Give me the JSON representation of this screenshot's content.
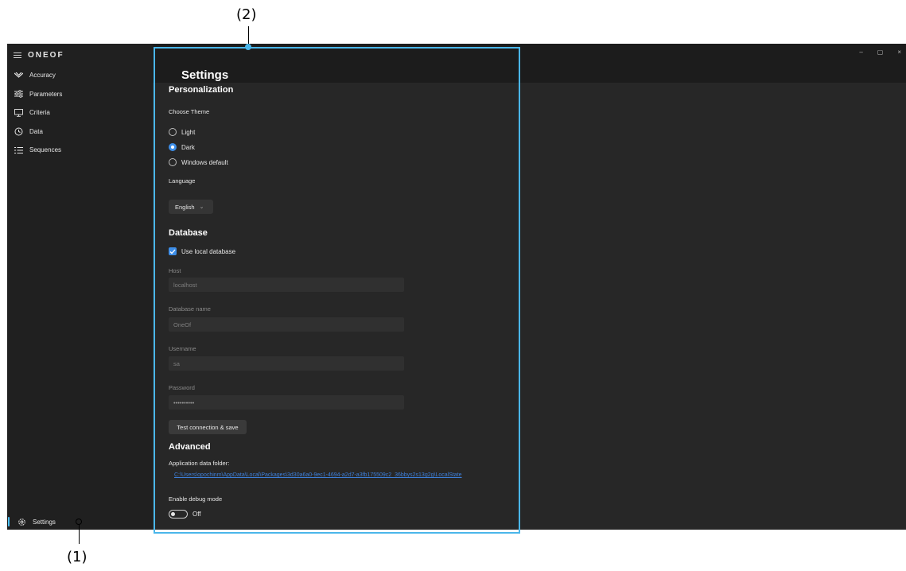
{
  "app": {
    "brand": "ONEOF",
    "window_controls": [
      "–",
      "▢",
      "×"
    ]
  },
  "sidebar": {
    "items": [
      {
        "label": "Accuracy",
        "icon": "bow-icon"
      },
      {
        "label": "Parameters",
        "icon": "sliders-icon"
      },
      {
        "label": "Criteria",
        "icon": "monitor-icon"
      },
      {
        "label": "Data",
        "icon": "clock-icon"
      },
      {
        "label": "Sequences",
        "icon": "list-icon"
      }
    ],
    "settings_label": "Settings"
  },
  "settings": {
    "title": "Settings",
    "personalization": {
      "heading": "Personalization",
      "choose_theme": "Choose Theme",
      "themes": [
        {
          "label": "Light",
          "selected": false
        },
        {
          "label": "Dark",
          "selected": true
        },
        {
          "label": "Windows default",
          "selected": false
        }
      ],
      "language_label": "Language",
      "language_value": "English",
      "language_chevron": "⌄"
    },
    "database": {
      "heading": "Database",
      "use_local_label": "Use local database",
      "use_local_checked": true,
      "host_label": "Host",
      "host_value": "localhost",
      "dbname_label": "Database name",
      "dbname_value": "OneOf",
      "username_label": "Username",
      "username_value": "sa",
      "password_label": "Password",
      "password_value": "••••••••••",
      "test_button": "Test connection & save"
    },
    "advanced": {
      "heading": "Advanced",
      "app_folder_label": "Application data folder:",
      "app_folder_path": "C:\\Users\\opochinm\\AppData\\Local\\Packages\\3d30a6a0-9ec1-4694-a2d7-a3fb175509c2_36bbys2s13g2g\\LocalState",
      "debug_label": "Enable debug mode",
      "debug_state": "Off"
    }
  },
  "annotations": {
    "callout_1": "(1)",
    "callout_2": "(2)",
    "box_color": "#4ab6ea"
  }
}
